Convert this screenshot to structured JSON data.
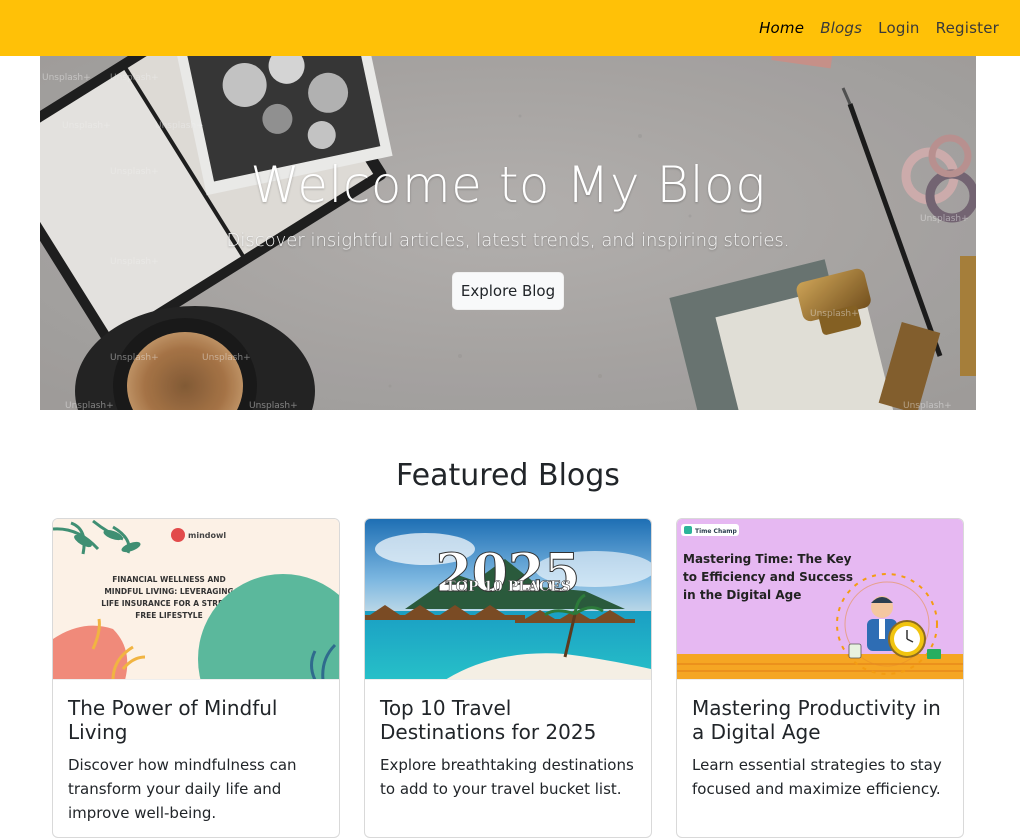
{
  "nav": {
    "links": [
      {
        "label": "Home"
      },
      {
        "label": "Blogs"
      },
      {
        "label": "Login"
      },
      {
        "label": "Register"
      }
    ]
  },
  "hero": {
    "title": "Welcome to My Blog",
    "subtitle": "Discover insightful articles, latest trends, and inspiring stories.",
    "button_label": "Explore Blog",
    "watermark": "Unsplash+"
  },
  "featured": {
    "title": "Featured Blogs",
    "cards": [
      {
        "title": "The Power of Mindful Living",
        "text": "Discover how mindfulness can transform your daily life and improve well-being.",
        "image": {
          "brand": "mindowl",
          "lines": [
            "FINANCIAL WELLNESS AND",
            "MINDFUL LIVING: LEVERAGING",
            "LIFE INSURANCE FOR A STRESS-",
            "FREE LIFESTYLE"
          ]
        }
      },
      {
        "title": "Top 10 Travel Destinations for 2025",
        "text": "Explore breathtaking destinations to add to your travel bucket list.",
        "image": {
          "year": "2025",
          "caption": "TOP 10 PLACES"
        }
      },
      {
        "title": "Mastering Productivity in a Digital Age",
        "text": "Learn essential strategies to stay focused and maximize efficiency.",
        "image": {
          "brand": "Time Champ",
          "lines": [
            "Mastering Time: The Key",
            "to Efficiency and Success",
            "in the Digital Age"
          ]
        }
      }
    ]
  },
  "colors": {
    "navbar": "#ffc107",
    "hero_overlay": "#c9c7c5",
    "card_border": "#dcdcdc"
  }
}
